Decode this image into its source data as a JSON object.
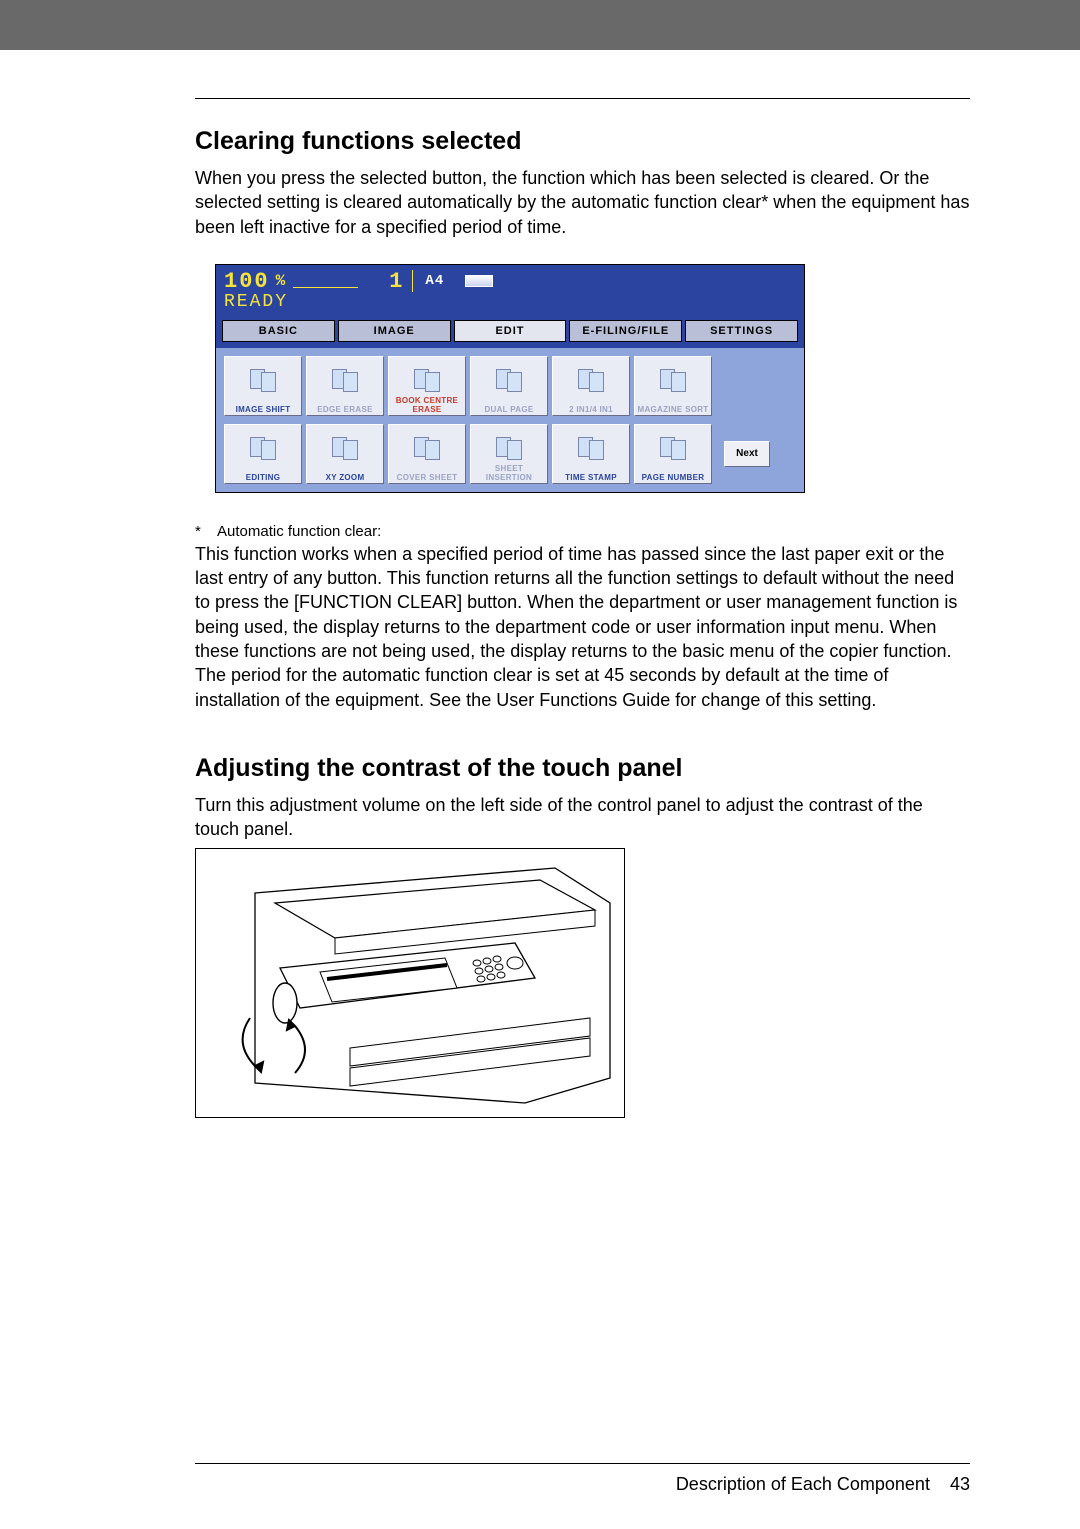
{
  "header_bar": {
    "color": "#696969"
  },
  "section1": {
    "title": "Clearing functions selected",
    "para": "When you press the selected button, the function which has been selected is cleared. Or the selected setting is cleared automatically by the automatic function clear* when the equipment has been left inactive for a specified period of time."
  },
  "touch_panel": {
    "status": {
      "zoom_value": "100",
      "zoom_unit": "%",
      "count": "1",
      "paper": "A4",
      "ready": "READY"
    },
    "tabs": [
      "BASIC",
      "IMAGE",
      "EDIT",
      "E-FILING/FILE",
      "SETTINGS"
    ],
    "active_tab_index": 2,
    "functions_row1": [
      {
        "label": "IMAGE SHIFT",
        "dim": false
      },
      {
        "label": "EDGE ERASE",
        "dim": true
      },
      {
        "label": "BOOK CENTRE ERASE",
        "dim": false
      },
      {
        "label": "DUAL PAGE",
        "dim": true
      },
      {
        "label": "2 IN1/4 IN1",
        "dim": true
      },
      {
        "label": "MAGAZINE SORT",
        "dim": true
      }
    ],
    "functions_row2": [
      {
        "label": "EDITING",
        "dim": false
      },
      {
        "label": "XY ZOOM",
        "dim": false
      },
      {
        "label": "COVER SHEET",
        "dim": true
      },
      {
        "label": "SHEET INSERTION",
        "dim": true
      },
      {
        "label": "TIME STAMP",
        "dim": false
      },
      {
        "label": "PAGE NUMBER",
        "dim": false
      }
    ],
    "next_label": "Next"
  },
  "note": {
    "heading": "Automatic function clear:",
    "text": "This function works when a specified period of time has passed since the last paper exit or the last entry of any button. This function returns all the function settings to default without the need to press the [FUNCTION CLEAR] button. When the department or user management function is being used, the display returns to the department code or user information input menu. When these functions are not being used, the display returns to the basic menu of the copier function. The period for the automatic function clear is set at 45 seconds by default at the time of installation of the equipment. See the User Functions Guide for change of this setting."
  },
  "section2": {
    "title": "Adjusting the contrast of the touch panel",
    "para": "Turn this adjustment volume on the left side of the control panel to adjust the contrast of the touch panel."
  },
  "footer": {
    "text": "Description of Each Component",
    "page_no": "43"
  }
}
